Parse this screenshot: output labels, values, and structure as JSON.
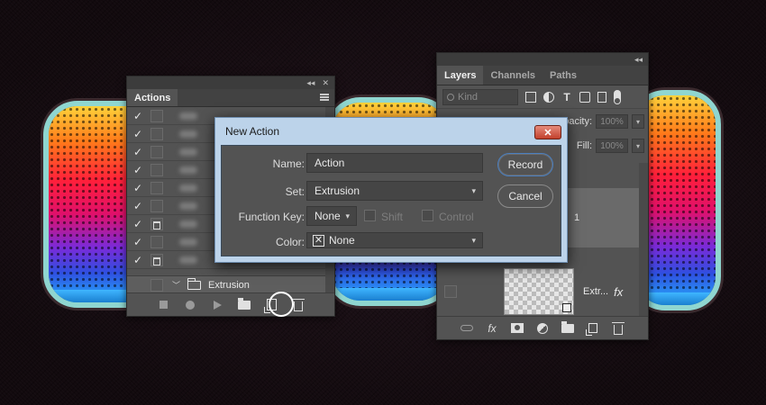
{
  "actions_panel": {
    "tab_label": "Actions",
    "rows": [
      {
        "checked": true,
        "dialog": false
      },
      {
        "checked": true,
        "dialog": false
      },
      {
        "checked": true,
        "dialog": false
      },
      {
        "checked": true,
        "dialog": false
      },
      {
        "checked": true,
        "dialog": false
      },
      {
        "checked": true,
        "dialog": false
      },
      {
        "checked": true,
        "dialog": true
      },
      {
        "checked": true,
        "dialog": false
      },
      {
        "checked": true,
        "dialog": true
      }
    ],
    "set_name": "Extrusion",
    "check_glyph": "✓",
    "chevron_glyph": "﹀"
  },
  "layers_panel": {
    "tabs": [
      "Layers",
      "Channels",
      "Paths"
    ],
    "kind_placeholder": "Kind",
    "opacity_label": "pacity:",
    "opacity_value": "100%",
    "fill_label": "Fill:",
    "fill_value": "100%",
    "layers": [
      {
        "name": "1"
      },
      {
        "name": "Extr...",
        "fx": "fx"
      }
    ]
  },
  "dialog": {
    "title": "New Action",
    "close_glyph": "✕",
    "name_label": "Name:",
    "name_value": "Action",
    "set_label": "Set:",
    "set_value": "Extrusion",
    "function_key_label": "Function Key:",
    "function_key_value": "None",
    "shift_label": "Shift",
    "control_label": "Control",
    "color_label": "Color:",
    "color_value": "None",
    "record_label": "Record",
    "cancel_label": "Cancel"
  },
  "colors": {
    "panel_bg": "#535353",
    "dialog_frame": "#bcd3ea",
    "primary_border": "#4a7fc0",
    "close_red": "#c2402c"
  }
}
